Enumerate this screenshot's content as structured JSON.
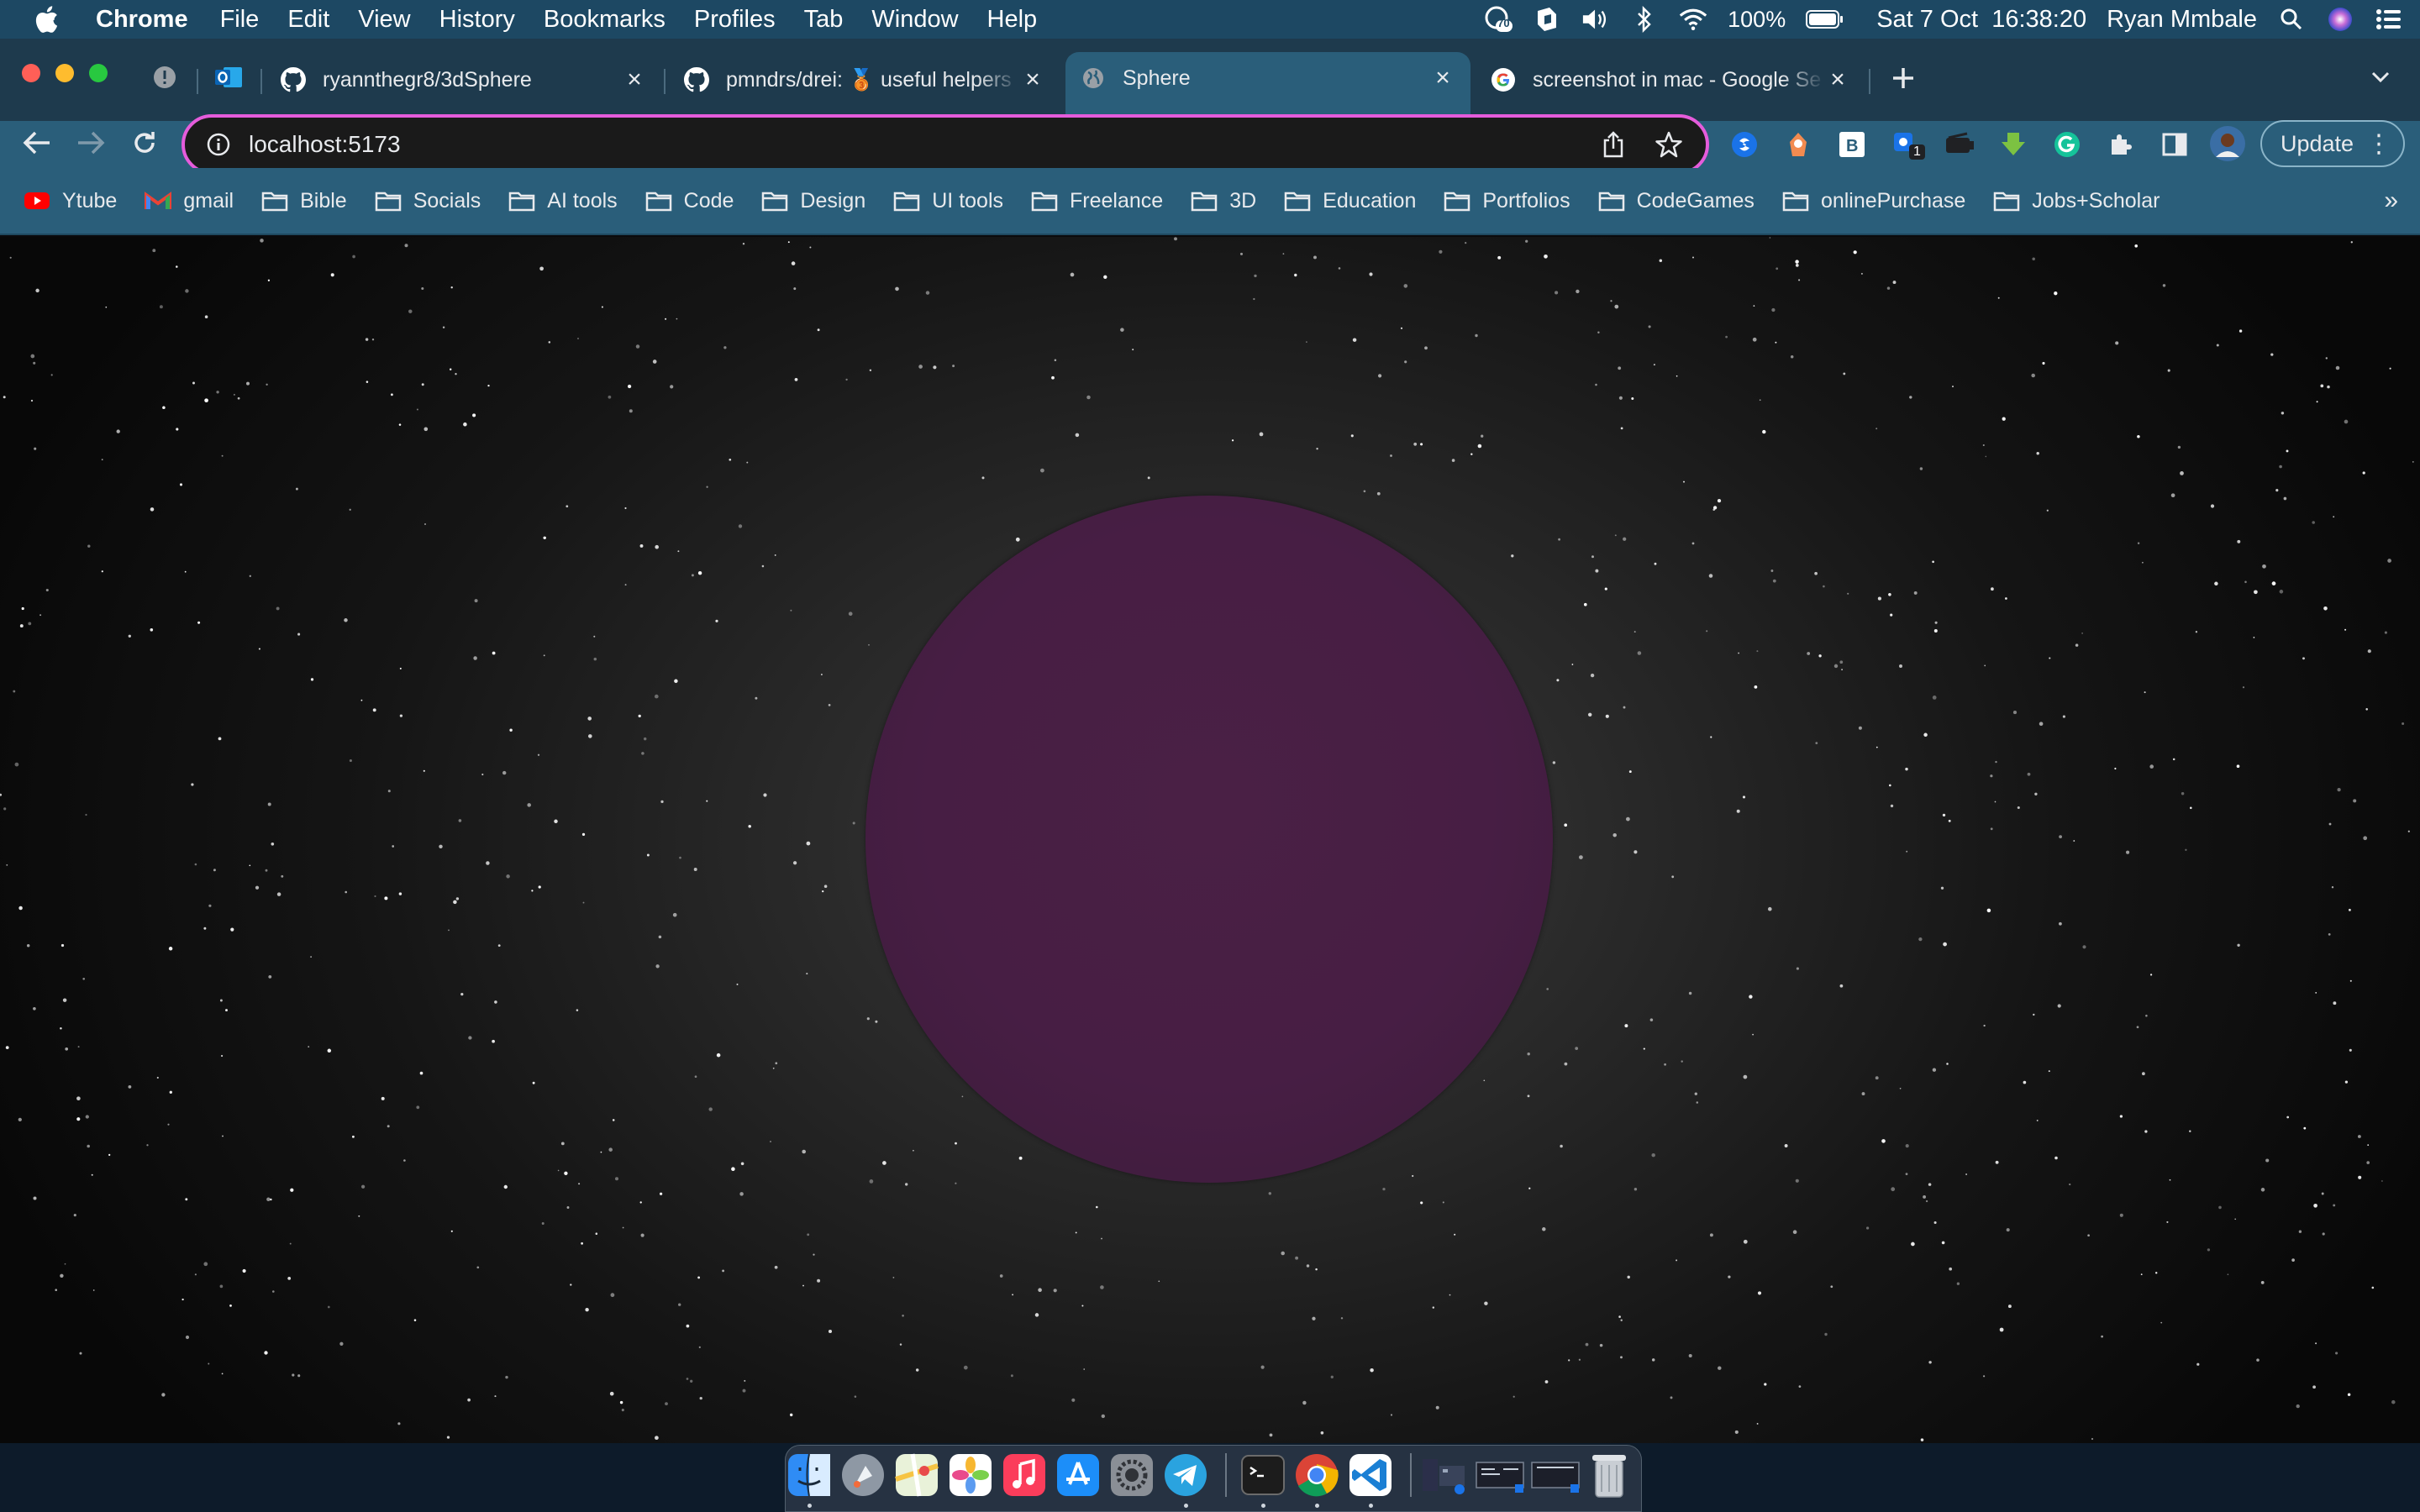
{
  "menubar": {
    "app_name": "Chrome",
    "items": [
      "File",
      "Edit",
      "View",
      "History",
      "Bookmarks",
      "Profiles",
      "Tab",
      "Window",
      "Help"
    ],
    "battery": "100%",
    "datetime": "Sat 7 Oct  16:38:20",
    "user": "Ryan Mmbale",
    "notification_count": "70"
  },
  "tabs": [
    {
      "title": "ryannthegr8/3dSphere",
      "icon": "github-icon",
      "active": false
    },
    {
      "title": "pmndrs/drei: 🥉 useful helpers",
      "icon": "github-icon",
      "active": false
    },
    {
      "title": "Sphere",
      "icon": "globe-icon",
      "active": true
    },
    {
      "title": "screenshot in mac - Google Se",
      "icon": "google-icon",
      "active": false
    }
  ],
  "omnibox": {
    "url": "localhost:5173"
  },
  "toolbar": {
    "update_label": "Update",
    "extension_badge": "1"
  },
  "bookmarks": [
    {
      "label": "Ytube",
      "icon": "youtube-icon"
    },
    {
      "label": "gmail",
      "icon": "gmail-icon"
    },
    {
      "label": "Bible",
      "icon": "folder-icon"
    },
    {
      "label": "Socials",
      "icon": "folder-icon"
    },
    {
      "label": "AI tools",
      "icon": "folder-icon"
    },
    {
      "label": "Code",
      "icon": "folder-icon"
    },
    {
      "label": "Design",
      "icon": "folder-icon"
    },
    {
      "label": "UI tools",
      "icon": "folder-icon"
    },
    {
      "label": "Freelance",
      "icon": "folder-icon"
    },
    {
      "label": "3D",
      "icon": "folder-icon"
    },
    {
      "label": "Education",
      "icon": "folder-icon"
    },
    {
      "label": "Portfolios",
      "icon": "folder-icon"
    },
    {
      "label": "CodeGames",
      "icon": "folder-icon"
    },
    {
      "label": "onlinePurchase",
      "icon": "folder-icon"
    },
    {
      "label": "Jobs+Scholar",
      "icon": "folder-icon"
    }
  ],
  "scene": {
    "sphere_color": "#471e44",
    "background_color": "#2a2a2a"
  },
  "dock_apps": [
    "finder-icon",
    "launchpad-icon",
    "maps-icon",
    "photos-icon",
    "music-icon",
    "app-store-icon",
    "system-settings-icon",
    "telegram-icon",
    "terminal-icon",
    "chrome-icon",
    "vscode-icon",
    "window-thumbnail-icon",
    "window-thumbnail-icon",
    "window-thumbnail-icon",
    "trash-icon"
  ]
}
